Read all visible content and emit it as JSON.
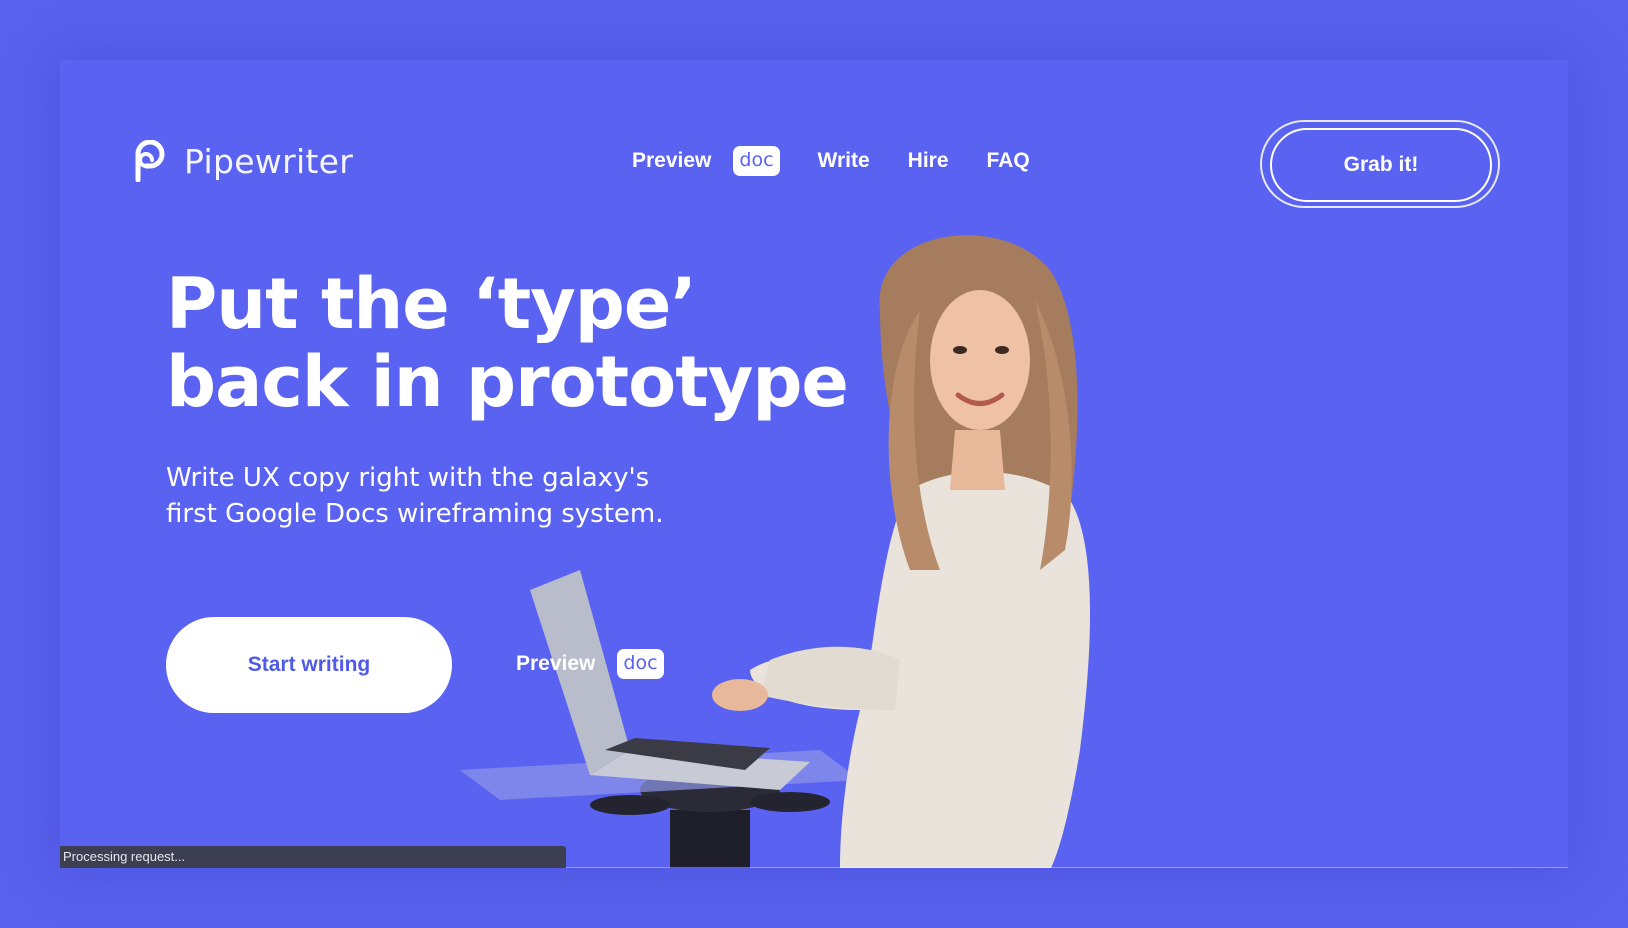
{
  "brand": {
    "name": "Pipewriter",
    "logo_icon": "pipewriter-logo-icon"
  },
  "nav": {
    "preview_label": "Preview",
    "preview_badge": "doc",
    "write_label": "Write",
    "hire_label": "Hire",
    "faq_label": "FAQ"
  },
  "cta_header": {
    "label": "Grab it!"
  },
  "hero": {
    "headline_line1": "Put the ‘type’",
    "headline_line2": "back in prototype",
    "subhead_line1": "Write UX copy right with the galaxy's",
    "subhead_line2": "first Google Docs wireframing system.",
    "start_label": "Start writing",
    "preview_label": "Preview",
    "preview_badge": "doc"
  },
  "status": {
    "text": "Processing request..."
  },
  "colors": {
    "background": "#5a63ef",
    "card": "#5a63f1",
    "accent_text": "#4f5ae8",
    "white": "#ffffff",
    "status_bar": "#3c3f52"
  }
}
